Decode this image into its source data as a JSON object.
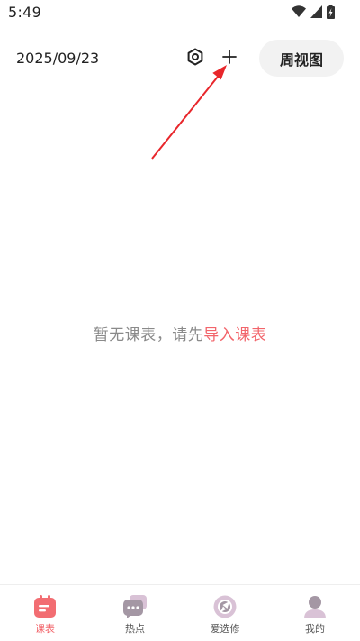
{
  "status_bar": {
    "time": "5:49"
  },
  "header": {
    "date": "2025/09/23",
    "week_view_label": "周视图"
  },
  "empty_state": {
    "message": "暂无课表，请先",
    "link_text": "导入课表"
  },
  "bottom_nav": {
    "items": [
      {
        "label": "课表",
        "icon": "calendar-icon",
        "active": true
      },
      {
        "label": "热点",
        "icon": "chat-bubbles-icon",
        "active": false
      },
      {
        "label": "爱选修",
        "icon": "explore-icon",
        "active": false
      },
      {
        "label": "我的",
        "icon": "person-icon",
        "active": false
      }
    ]
  },
  "colors": {
    "accent": "#f2656b",
    "button_bg": "#f2f2f2",
    "text_gray": "#8a8a8a",
    "annotation_arrow": "#e8262b"
  }
}
